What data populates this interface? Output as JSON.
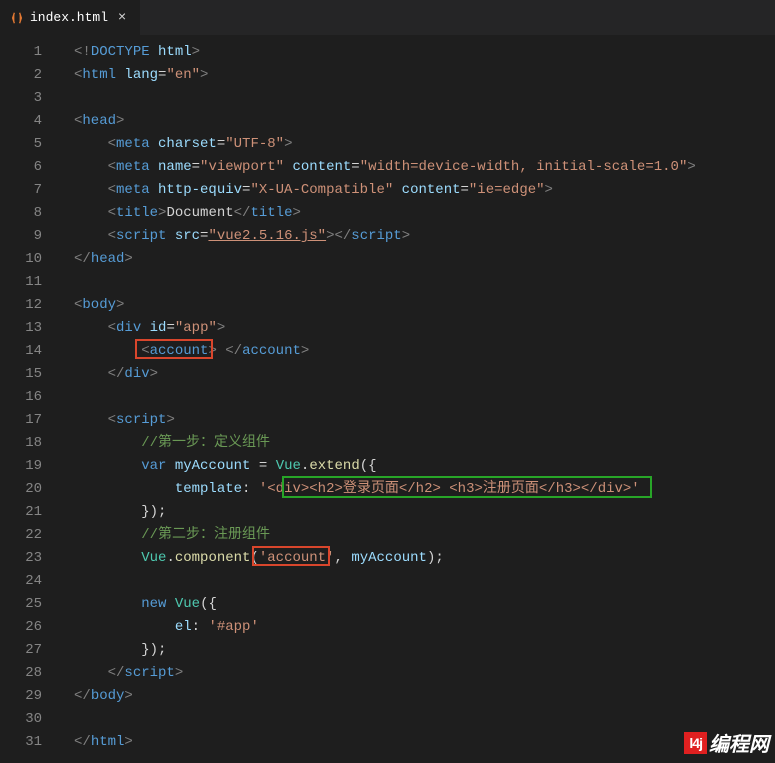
{
  "tab": {
    "filename": "index.html",
    "close_glyph": "×"
  },
  "lines": {
    "count": 31
  },
  "code": {
    "l1": {
      "open": "<!",
      "name": "DOCTYPE",
      "attr": " html",
      "close": ">"
    },
    "l2": {
      "open": "<",
      "name": "html",
      "attr1": " lang",
      "eq": "=",
      "str": "\"en\"",
      "close": ">"
    },
    "l4": {
      "open": "<",
      "name": "head",
      "close": ">"
    },
    "l5": {
      "open": "<",
      "name": "meta",
      "attr1": " charset",
      "eq": "=",
      "str": "\"UTF-8\"",
      "close": ">"
    },
    "l6": {
      "open": "<",
      "name": "meta",
      "attr1": " name",
      "eq": "=",
      "str1": "\"viewport\"",
      "attr2": " content",
      "str2": "\"width=device-width, initial-scale=1.0\"",
      "close": ">"
    },
    "l7": {
      "open": "<",
      "name": "meta",
      "attr1": " http-equiv",
      "eq": "=",
      "str1": "\"X-UA-Compatible\"",
      "attr2": " content",
      "str2": "\"ie=edge\"",
      "close": ">"
    },
    "l8": {
      "open": "<",
      "name": "title",
      "close1": ">",
      "text": "Document",
      "open2": "</",
      "close2": ">"
    },
    "l9": {
      "open": "<",
      "name": "script",
      "attr1": " src",
      "eq": "=",
      "str": "\"vue2.5.16.js\"",
      "close1": ">",
      "open2": "</",
      "close2": ">"
    },
    "l10": {
      "open": "</",
      "name": "head",
      "close": ">"
    },
    "l12": {
      "open": "<",
      "name": "body",
      "close": ">"
    },
    "l13": {
      "open": "<",
      "name": "div",
      "attr1": " id",
      "eq": "=",
      "str": "\"app\"",
      "close": ">"
    },
    "l14": {
      "open": "<",
      "name": "account",
      "close1": ">",
      "space": " ",
      "open2": "</",
      "close2": ">"
    },
    "l15": {
      "open": "</",
      "name": "div",
      "close": ">"
    },
    "l17": {
      "open": "<",
      "name": "script",
      "close": ">"
    },
    "l18": {
      "cmt": "//第一步：定义组件"
    },
    "l19": {
      "kw": "var",
      "sp": " ",
      "id": "myAccount",
      "eq": " = ",
      "obj": "Vue",
      "dot": ".",
      "call": "extend",
      "open": "({"
    },
    "l20": {
      "key": "template",
      "colon": ": ",
      "str": "'<div><h2>登录页面</h2> <h3>注册页面</h3></div>'"
    },
    "l21": {
      "close": "});"
    },
    "l22": {
      "cmt": "//第二步：注册组件"
    },
    "l23": {
      "obj": "Vue",
      "dot": ".",
      "call": "component",
      "open": "(",
      "str": "'account'",
      "comma": ", ",
      "id": "myAccount",
      "close": ");"
    },
    "l25": {
      "kw": "new",
      "sp": " ",
      "obj": "Vue",
      "open": "({"
    },
    "l26": {
      "key": "el",
      "colon": ": ",
      "str": "'#app'"
    },
    "l27": {
      "close": "});"
    },
    "l28": {
      "open": "</",
      "name": "script",
      "close": ">"
    },
    "l29": {
      "open": "</",
      "name": "body",
      "close": ">"
    },
    "l31": {
      "open": "</",
      "name": "html",
      "close": ">"
    }
  },
  "watermark": {
    "logo": "l4j",
    "text": "编程网"
  }
}
